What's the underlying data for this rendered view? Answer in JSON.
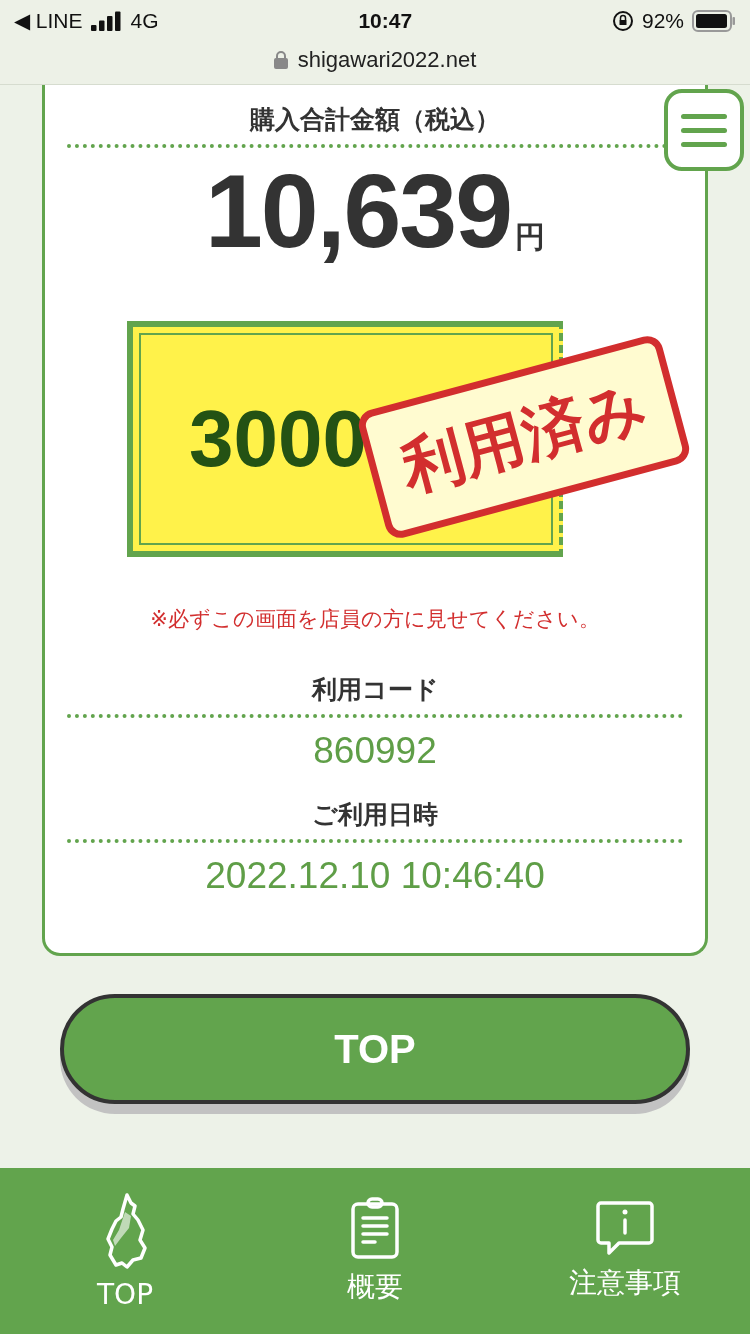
{
  "status_bar": {
    "back_app": "◀ LINE",
    "network": "4G",
    "time": "10:47",
    "battery": "92%",
    "url": "shigawari2022.net"
  },
  "receipt": {
    "total_label": "購入合計金額（税込）",
    "total_amount": "10,639",
    "currency": "円",
    "coupon": {
      "amount": "3000",
      "used": true,
      "stamp": "利用済み"
    },
    "notice": "※必ずこの画面を店員の方に見せてください。",
    "code_label": "利用コード",
    "code": "860992",
    "datetime_label": "ご利用日時",
    "datetime": "2022.12.10 10:46:40"
  },
  "top_button": "TOP",
  "bottom_nav": [
    {
      "kind": "map",
      "label": "TOP"
    },
    {
      "kind": "clipboard",
      "label": "概要"
    },
    {
      "kind": "info",
      "label": "注意事項"
    }
  ]
}
